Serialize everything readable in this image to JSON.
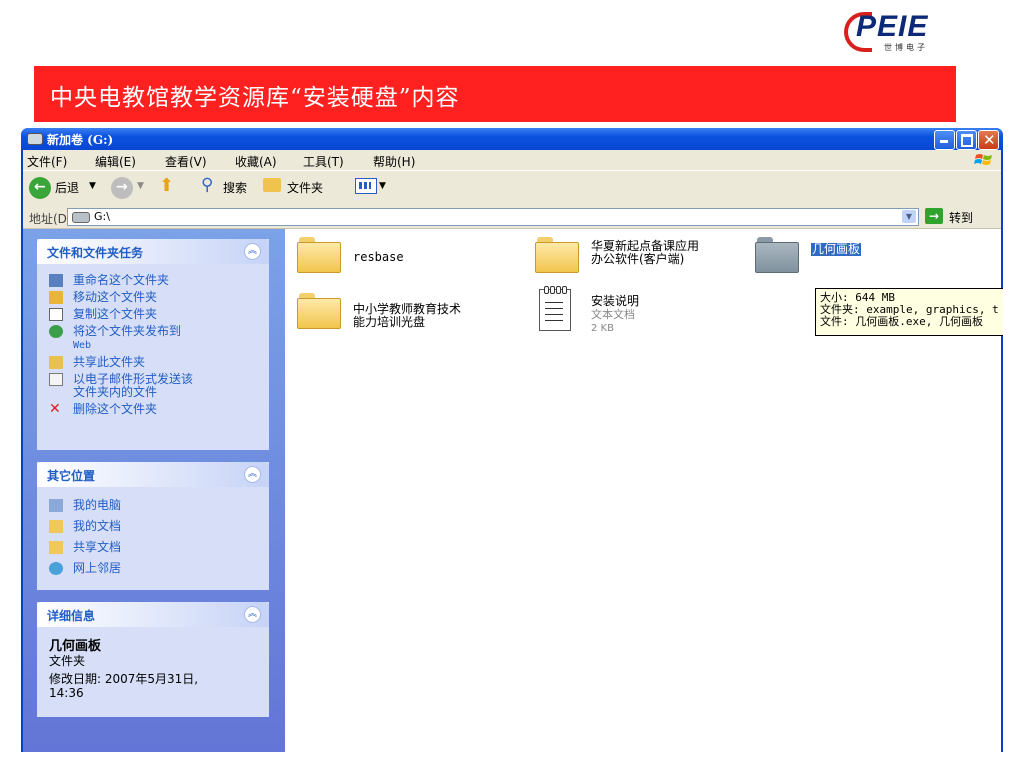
{
  "slide": {
    "logo_text": "PEIE",
    "logo_sub": "世博电子",
    "banner_title": "中央电教馆教学资源库“安装硬盘”内容"
  },
  "window": {
    "title": "新加卷 (G:)",
    "menu": [
      "文件(F)",
      "编辑(E)",
      "查看(V)",
      "收藏(A)",
      "工具(T)",
      "帮助(H)"
    ],
    "toolbar": {
      "back": "后退",
      "search": "搜索",
      "folders": "文件夹"
    },
    "address": {
      "label": "地址(D)",
      "value": "G:\\",
      "go": "转到"
    }
  },
  "tasks_panel": {
    "title": "文件和文件夹任务",
    "items": [
      {
        "label": "重命名这个文件夹",
        "icon": "rename-icon"
      },
      {
        "label": "移动这个文件夹",
        "icon": "move-icon"
      },
      {
        "label": "复制这个文件夹",
        "icon": "copy-icon"
      },
      {
        "label": "将这个文件夹发布到",
        "label2": "Web",
        "icon": "publish-web-icon"
      },
      {
        "label": "共享此文件夹",
        "icon": "share-icon"
      },
      {
        "label": "以电子邮件形式发送该",
        "label2": "文件夹内的文件",
        "icon": "email-icon"
      },
      {
        "label": "删除这个文件夹",
        "icon": "delete-icon"
      }
    ]
  },
  "places_panel": {
    "title": "其它位置",
    "items": [
      {
        "label": "我的电脑",
        "icon": "computer-icon"
      },
      {
        "label": "我的文档",
        "icon": "documents-icon"
      },
      {
        "label": "共享文档",
        "icon": "shared-docs-icon"
      },
      {
        "label": "网上邻居",
        "icon": "network-icon"
      }
    ]
  },
  "details_panel": {
    "title": "详细信息",
    "name": "几何画板",
    "type": "文件夹",
    "modified_line1": "修改日期: 2007年5月31日,",
    "modified_line2": "14:36"
  },
  "files": [
    {
      "name": "resbase",
      "kind": "folder"
    },
    {
      "name": "华夏新起点备课应用",
      "name2": "办公软件(客户端)",
      "kind": "folder"
    },
    {
      "name": "几何画板",
      "kind": "folder",
      "selected": true
    },
    {
      "name": "中小学教师教育技术",
      "name2": "能力培训光盘",
      "kind": "folder"
    },
    {
      "name": "安装说明",
      "sub1": "文本文档",
      "sub2": "2 KB",
      "kind": "text-document"
    }
  ],
  "tooltip": {
    "line1": "大小: 644 MB",
    "line2": "文件夹: example, graphics, t",
    "line3": "文件: 几何画板.exe, 几何画板"
  },
  "colors": {
    "banner": "#ff2020",
    "title_bar": "#0a52e0",
    "task_pane": "#7ba2e7",
    "selection": "#316ac5"
  }
}
